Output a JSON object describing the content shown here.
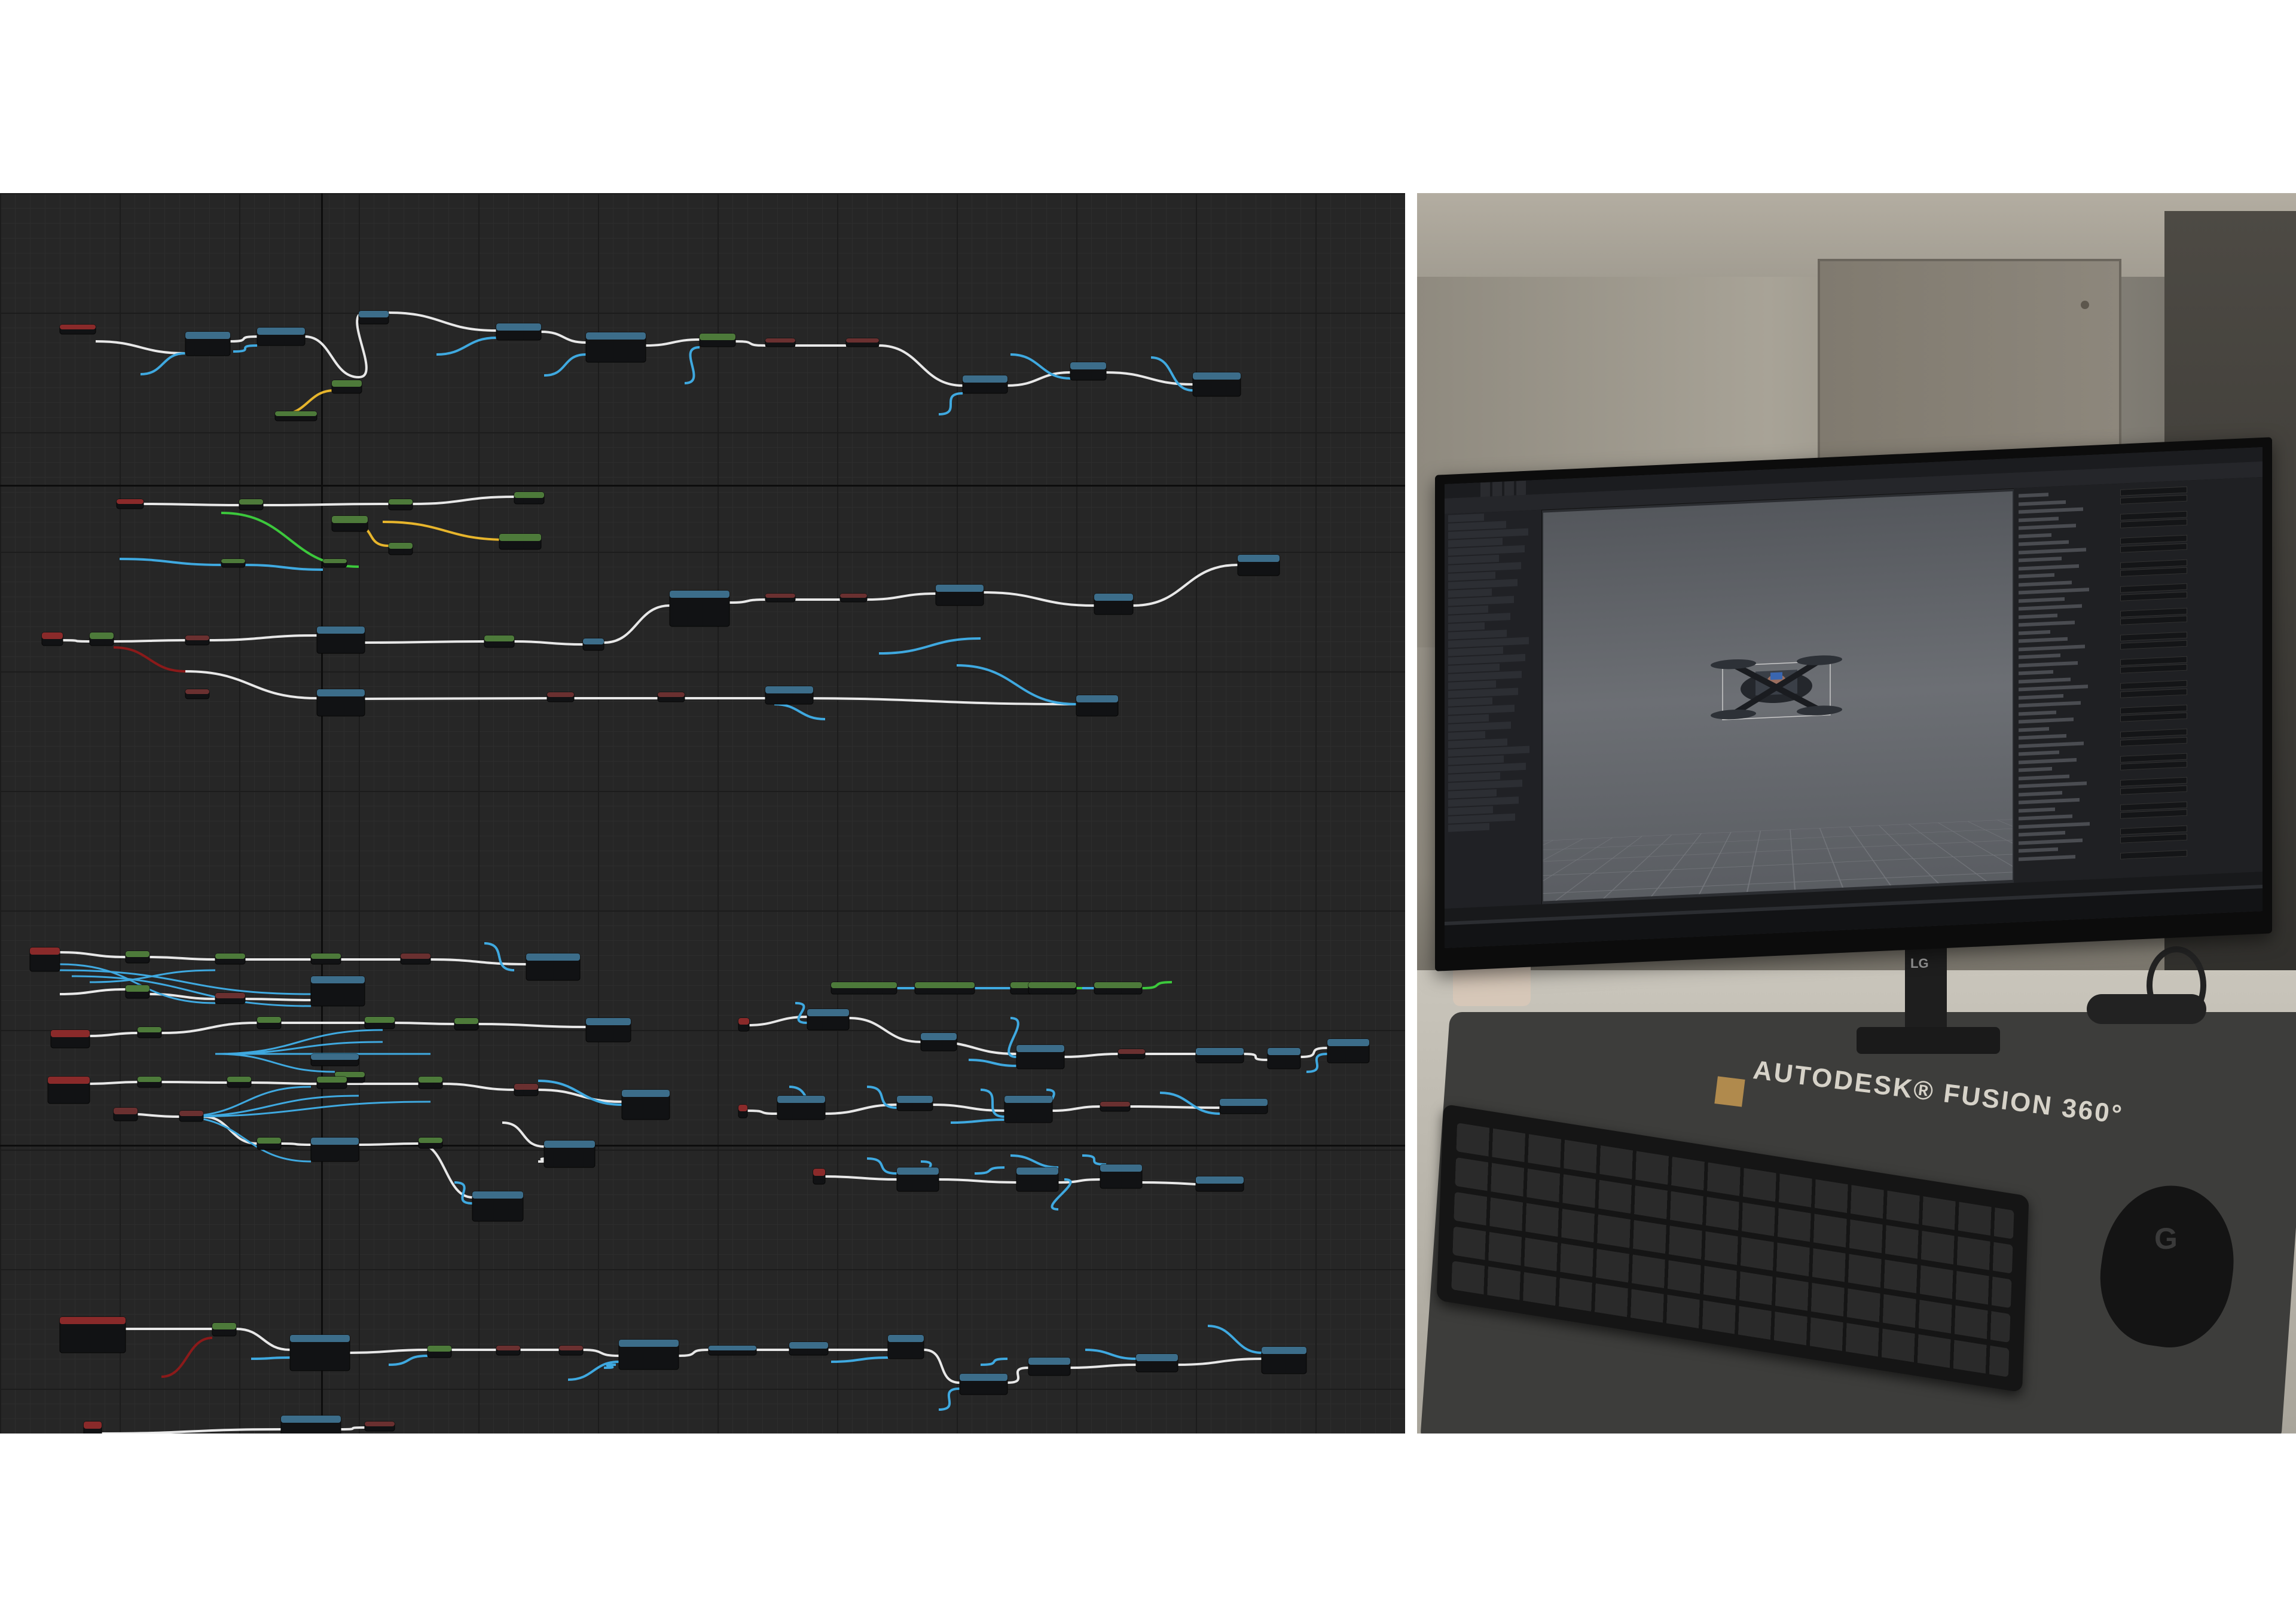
{
  "blueprint_graph": {
    "background_color": "#262626",
    "wire_colors": {
      "exec": "#e8e8e8",
      "float": "#3fa9e0",
      "bool": "#8b1a1a",
      "vector": "#e7b52c",
      "object": "#3cc83c"
    },
    "node_header_colors": {
      "function": "#3c6d8a",
      "pure": "#4d7a3a",
      "event": "#8a2a2a",
      "variable": "#6a3030"
    }
  },
  "photo": {
    "mat_brand": "AUTODESK® FUSION 360°",
    "monitor_brand": "LG",
    "mouse_brand": "G",
    "viewport_palette": {
      "sky": "#6c6f74",
      "grid": "#7d8085"
    }
  },
  "editor": {
    "tabs": [
      "",
      "",
      "",
      ""
    ],
    "icons": [
      "ue-logo-icon",
      "play-icon",
      "settings-icon",
      "close-icon"
    ]
  }
}
